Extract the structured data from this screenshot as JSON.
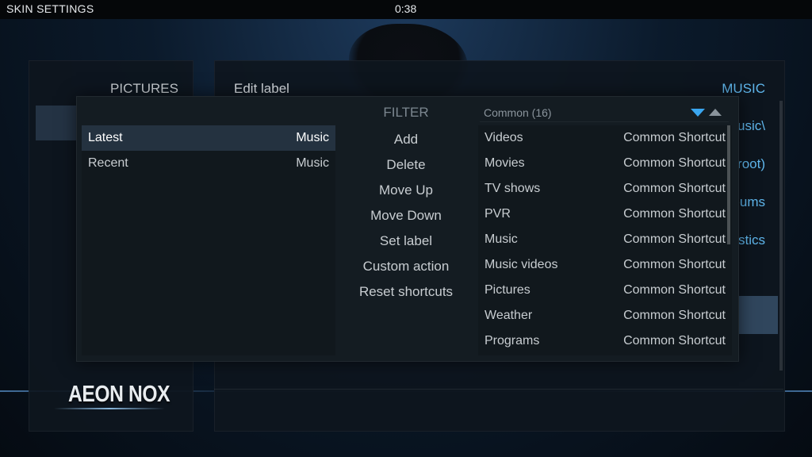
{
  "topbar": {
    "title": "SKIN SETTINGS",
    "clock": "0:38"
  },
  "left_panel": {
    "header": "PICTURES"
  },
  "right_panel": {
    "edit_label": "Edit label",
    "category": "MUSIC",
    "peek_items": [
      "usic\\",
      "root)",
      "bums",
      "stics"
    ]
  },
  "logo": "AEON NOX",
  "dialog": {
    "filter_label": "FILTER",
    "filter_value": "Common (16)",
    "shortcuts": [
      {
        "name": "Latest",
        "type": "Music",
        "selected": true
      },
      {
        "name": "Recent",
        "type": "Music",
        "selected": false
      }
    ],
    "actions": [
      "Add",
      "Delete",
      "Move Up",
      "Move Down",
      "Set label",
      "Custom action",
      "Reset shortcuts"
    ],
    "available": [
      {
        "name": "Videos",
        "type": "Common Shortcut"
      },
      {
        "name": "Movies",
        "type": "Common Shortcut"
      },
      {
        "name": "TV shows",
        "type": "Common Shortcut"
      },
      {
        "name": "PVR",
        "type": "Common Shortcut"
      },
      {
        "name": "Music",
        "type": "Common Shortcut"
      },
      {
        "name": "Music videos",
        "type": "Common Shortcut"
      },
      {
        "name": "Pictures",
        "type": "Common Shortcut"
      },
      {
        "name": "Weather",
        "type": "Common Shortcut"
      },
      {
        "name": "Programs",
        "type": "Common Shortcut"
      }
    ]
  }
}
